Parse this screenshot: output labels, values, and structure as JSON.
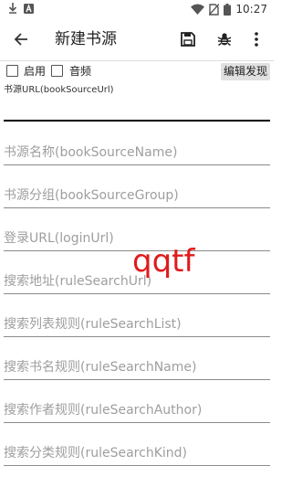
{
  "status_bar": {
    "time": "10:27",
    "icons": [
      "download-icon",
      "app-a-icon",
      "wifi-icon",
      "no-sim-icon",
      "battery-icon"
    ]
  },
  "toolbar": {
    "title": "新建书源",
    "icons": [
      "back-arrow-icon",
      "save-icon",
      "bug-debug-icon",
      "more-vert-icon"
    ]
  },
  "options": {
    "enable_label": "启用",
    "audio_label": "音频",
    "edit_discover_label": "编辑发现"
  },
  "fields": {
    "source_url_label": "书源URL(bookSourceUrl)",
    "source_name": "书源名称(bookSourceName)",
    "source_group": "书源分组(bookSourceGroup)",
    "login_url": "登录URL(loginUrl)",
    "search_url": "搜索地址(ruleSearchUrl)",
    "search_list": "搜索列表规则(ruleSearchList)",
    "search_name": "搜索书名规则(ruleSearchName)",
    "search_author": "搜索作者规则(ruleSearchAuthor)",
    "search_kind": "搜索分类规则(ruleSearchKind)"
  },
  "watermark": "qqtf",
  "colors": {
    "accent_underline": "#000000",
    "hint_text": "#9e9e9e",
    "watermark": "#e01b1b"
  }
}
